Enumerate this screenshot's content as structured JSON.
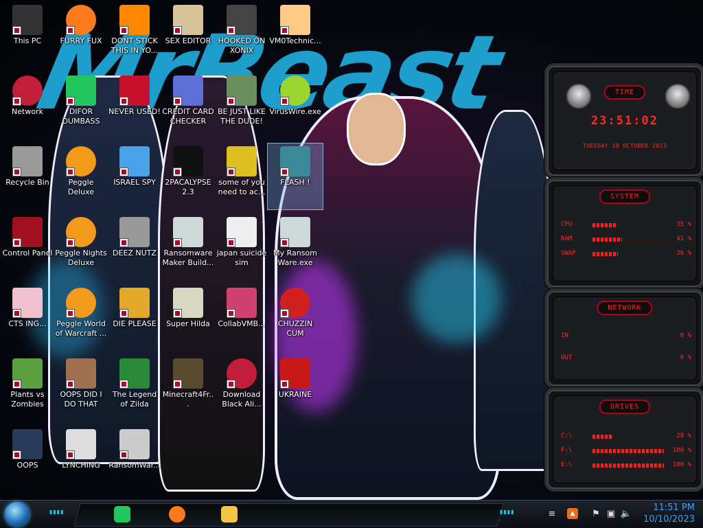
{
  "desktop_icons": [
    {
      "label": "This PC",
      "icon": "this-pc-icon"
    },
    {
      "label": "FURRY FUX",
      "icon": "firefox-icon"
    },
    {
      "label": "DONT STICK THIS IN YO...",
      "icon": "vlc-cone-icon"
    },
    {
      "label": "SEX EDITOR",
      "icon": "editor-icon"
    },
    {
      "label": "HOOKED ON XONIX",
      "icon": "xonix-icon"
    },
    {
      "label": "VM0Technic...",
      "icon": "doctor-icon"
    },
    {
      "label": "Network",
      "icon": "network-icon"
    },
    {
      "label": "DIFOR DUMBASS",
      "icon": "chat-app-icon"
    },
    {
      "label": "NEVER USED!",
      "icon": "dev-cpp-icon"
    },
    {
      "label": "CREDIT CARD CHECKER",
      "icon": "credit-card-icon"
    },
    {
      "label": "BE JUST LIKE THE DUDE!",
      "icon": "santa-icon"
    },
    {
      "label": "VirusWire.exe",
      "icon": "lime-icon"
    },
    {
      "label": "Recycle Bin",
      "icon": "recycle-bin-icon"
    },
    {
      "label": "Peggle Deluxe",
      "icon": "peggle-icon"
    },
    {
      "label": "ISRAEL SPY",
      "icon": "spy-icon"
    },
    {
      "label": "2PACALYPSE 2.3",
      "icon": "terminal-icon"
    },
    {
      "label": "some of you need to ac...",
      "icon": "beaver-icon"
    },
    {
      "label": "FLASH !",
      "icon": "flash-icon"
    },
    {
      "label": "Control Panel",
      "icon": "control-panel-icon"
    },
    {
      "label": "Peggle Nights Deluxe",
      "icon": "peggle-icon"
    },
    {
      "label": "DEEZ NUTZ",
      "icon": "windows-stack-icon"
    },
    {
      "label": "Ransomware Maker Build...",
      "icon": "window-app-icon"
    },
    {
      "label": "japan suicide sim",
      "icon": "document-icon"
    },
    {
      "label": "My Ransom Ware.exe",
      "icon": "window-app-icon"
    },
    {
      "label": "CTS ING...",
      "icon": "cartoon-icon"
    },
    {
      "label": "Peggle World of Warcraft ...",
      "icon": "peggle-icon"
    },
    {
      "label": "DIE PLEASE",
      "icon": "de-icon"
    },
    {
      "label": "Super Hilda",
      "icon": "pixel-icon"
    },
    {
      "label": "CollabVMB...",
      "icon": "monitor-icon"
    },
    {
      "label": "CHUZZIN CUM",
      "icon": "chuzzle-icon"
    },
    {
      "label": "Plants vs Zombies",
      "icon": "plants-icon"
    },
    {
      "label": "OOPS DID I DO THAT",
      "icon": "portrait-icon"
    },
    {
      "label": "The Legend of Zilda",
      "icon": "link-icon"
    },
    {
      "label": "Minecraft4Fr...",
      "icon": "minecraft-icon"
    },
    {
      "label": "Download Black Ali...",
      "icon": "network-icon"
    },
    {
      "label": "UKRAINE",
      "icon": "radiation-icon"
    },
    {
      "label": "OOPS",
      "icon": "oops-icon"
    },
    {
      "label": "LYNCHING",
      "icon": "lynching-icon"
    },
    {
      "label": "RansomWar...",
      "icon": "skull-icon"
    }
  ],
  "widget": {
    "time": {
      "title": "TIME",
      "clock": "23:51:02",
      "date": "TUESDAY 10 OCTOBER 2023"
    },
    "system": {
      "title": "SYSTEM",
      "rows": [
        {
          "key": "CPU",
          "value": "35 %",
          "level": 0.35
        },
        {
          "key": "RAM",
          "value": "41 %",
          "level": 0.41
        },
        {
          "key": "SWAP",
          "value": "36 %",
          "level": 0.36
        }
      ]
    },
    "network": {
      "title": "NETWORK",
      "rows": [
        {
          "key": "IN",
          "value": "0 %"
        },
        {
          "key": "OUT",
          "value": "0 %"
        }
      ]
    },
    "drives": {
      "title": "DRIVES",
      "rows": [
        {
          "key": "C:\\",
          "value": "28 %",
          "level": 0.28
        },
        {
          "key": "F:\\",
          "value": "100 %",
          "level": 1.0
        },
        {
          "key": "E:\\",
          "value": "100 %",
          "level": 1.0
        }
      ]
    }
  },
  "wallpaper": {
    "logo_text": "MrBeast"
  },
  "taskbar": {
    "pinned": [
      {
        "name": "chat-app",
        "color": "#22c55e"
      },
      {
        "name": "firefox",
        "color": "#ff7a1a"
      },
      {
        "name": "file-explorer",
        "color": "#f4c542"
      }
    ],
    "tray": {
      "time": "11:51 PM",
      "date": "10/10/2023"
    }
  },
  "colors": {
    "accent_red": "#ff2a2a",
    "accent_cyan": "#19c7e8",
    "clock_blue": "#3aa0ff"
  }
}
